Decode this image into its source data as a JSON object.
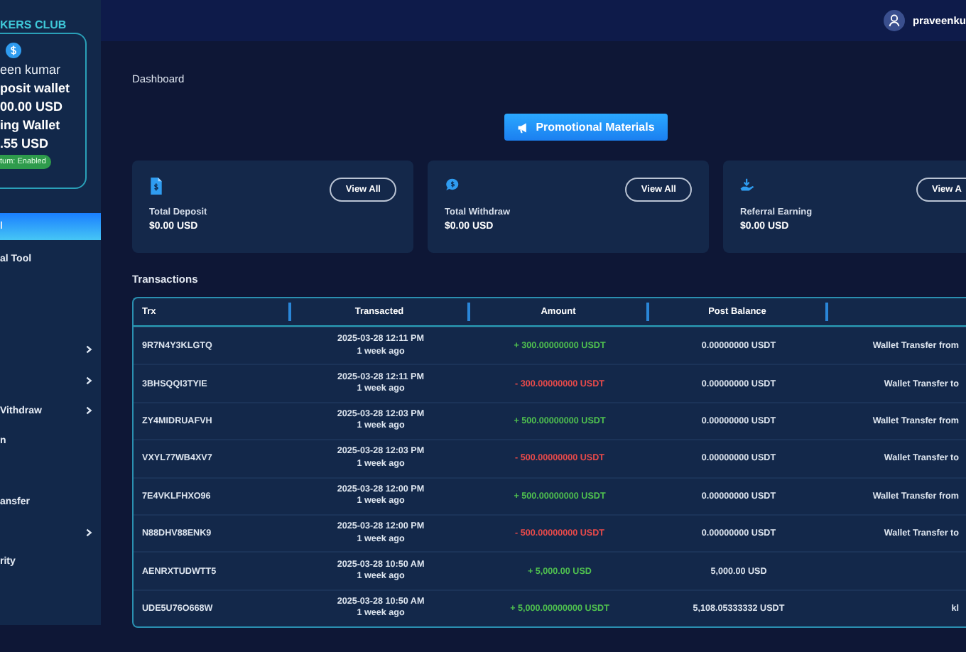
{
  "sidebar": {
    "brand": "KERS CLUB",
    "wallet": {
      "name": "een kumar",
      "deposit_label": "posit wallet",
      "deposit_value": "00.00 USD",
      "earning_label": "ing Wallet",
      "earning_value": ".55 USD",
      "badge": "tum: Enabled"
    },
    "items": [
      {
        "label": "l",
        "selected": true,
        "expandable": false
      },
      {
        "label": "al Tool",
        "selected": false,
        "expandable": false
      },
      {
        "selected": false,
        "expandable": false
      },
      {
        "selected": false,
        "expandable": false
      },
      {
        "selected": false,
        "expandable": true
      },
      {
        "selected": false,
        "expandable": true
      },
      {
        "label": "Vithdraw",
        "selected": false,
        "expandable": true
      },
      {
        "label": "n",
        "selected": false,
        "expandable": false
      },
      {
        "selected": false,
        "expandable": false
      },
      {
        "label": "ansfer",
        "selected": false,
        "expandable": false
      },
      {
        "selected": false,
        "expandable": true
      },
      {
        "label": "rity",
        "selected": false,
        "expandable": false
      }
    ]
  },
  "topbar": {
    "user": "praveenku"
  },
  "page_title": "Dashboard",
  "promo_button": "Promotional Materials",
  "stats": [
    {
      "kind": "deposit",
      "label": "Total Deposit",
      "value": "$0.00 USD",
      "button": "View All"
    },
    {
      "kind": "withdraw",
      "label": "Total Withdraw",
      "value": "$0.00 USD",
      "button": "View All"
    },
    {
      "kind": "referral",
      "label": "Referral Earning",
      "value": "$0.00 USD",
      "button": "View A"
    }
  ],
  "transactions": {
    "title": "Transactions",
    "columns": [
      "Trx",
      "Transacted",
      "Amount",
      "Post Balance"
    ],
    "rows": [
      {
        "trx": "9R7N4Y3KLGTQ",
        "date": "2025-03-28 12:11 PM",
        "ago": "1 week ago",
        "kind": "credit",
        "amount": "+ 300.00000000 USDT",
        "balance": "0.00000000 USDT",
        "details": "Wallet Transfer from"
      },
      {
        "trx": "3BHSQQI3TYIE",
        "date": "2025-03-28 12:11 PM",
        "ago": "1 week ago",
        "kind": "debit",
        "amount": "- 300.00000000 USDT",
        "balance": "0.00000000 USDT",
        "details": "Wallet Transfer to"
      },
      {
        "trx": "ZY4MIDRUAFVH",
        "date": "2025-03-28 12:03 PM",
        "ago": "1 week ago",
        "kind": "credit",
        "amount": "+ 500.00000000 USDT",
        "balance": "0.00000000 USDT",
        "details": "Wallet Transfer from"
      },
      {
        "trx": "VXYL77WB4XV7",
        "date": "2025-03-28 12:03 PM",
        "ago": "1 week ago",
        "kind": "debit",
        "amount": "- 500.00000000 USDT",
        "balance": "0.00000000 USDT",
        "details": "Wallet Transfer to"
      },
      {
        "trx": "7E4VKLFHXO96",
        "date": "2025-03-28 12:00 PM",
        "ago": "1 week ago",
        "kind": "credit",
        "amount": "+ 500.00000000 USDT",
        "balance": "0.00000000 USDT",
        "details": "Wallet Transfer from"
      },
      {
        "trx": "N88DHV88ENK9",
        "date": "2025-03-28 12:00 PM",
        "ago": "1 week ago",
        "kind": "debit",
        "amount": "- 500.00000000 USDT",
        "balance": "0.00000000 USDT",
        "details": "Wallet Transfer to"
      },
      {
        "trx": "AENRXTUDWTT5",
        "date": "2025-03-28 10:50 AM",
        "ago": "1 week ago",
        "kind": "credit",
        "amount": "+ 5,000.00 USD",
        "balance": "5,000.00 USD"
      },
      {
        "trx": "UDE5U76O668W",
        "date": "2025-03-28 10:50 AM",
        "ago": "1 week ago",
        "kind": "credit",
        "amount": "+ 5,000.00000000 USDT",
        "balance": "5,108.05333332 USDT",
        "details": "kl"
      }
    ]
  }
}
